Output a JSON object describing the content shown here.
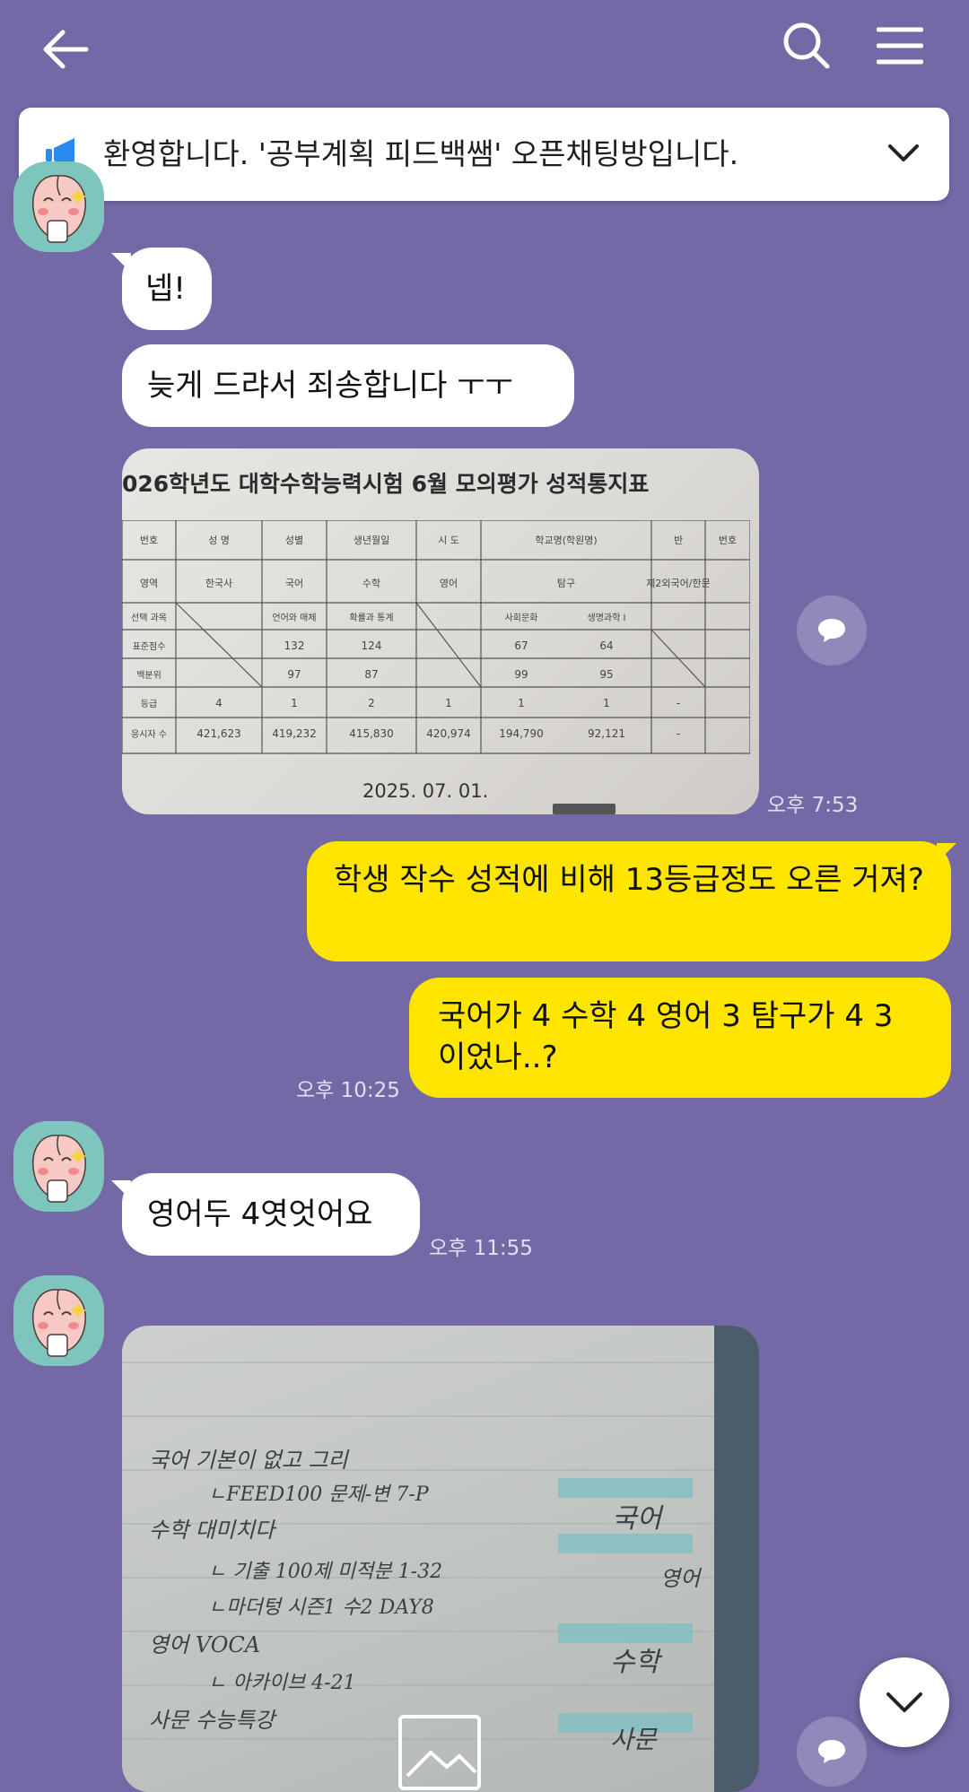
{
  "header": {
    "back_icon": "arrow-left-icon",
    "search_icon": "search-icon",
    "menu_icon": "menu-icon"
  },
  "notice": {
    "icon": "megaphone-icon",
    "text": "환영합니다. '공부계획  피드백쌤' 오픈채팅방입니다.",
    "expand_icon": "chevron-down-icon"
  },
  "messages": [
    {
      "side": "left",
      "text": "넵!"
    },
    {
      "side": "left",
      "text": "늦게 드랴서 죄송합니다 ㅜㅜ"
    },
    {
      "side": "left",
      "type": "photo",
      "time": "오후 7:53",
      "doc_title": "026학년도 대학수학능력시험 6월 모의평가 성적통지표",
      "doc_date": "2025. 07. 01."
    },
    {
      "side": "right",
      "text": "   학생 작수 성적에 비해 13등급정도 오른 거져?"
    },
    {
      "side": "right",
      "text": "국어가 4 수학 4 영어 3 탐구가 4 3 이었나..?",
      "time": "오후 10:25"
    },
    {
      "side": "left",
      "text": "영어두 4엿엇어요",
      "time": "오후 11:55"
    },
    {
      "side": "left",
      "type": "photo",
      "notes": [
        "국어   기본이 없고 그리",
        "ㄴFEED100 문제-변 7-P",
        "수학  대미치다",
        "ㄴ 기출 100제 미적분 1-32",
        "ㄴ마더텅 시즌1 수2 DAY8",
        "영어   VOCA",
        "ㄴ 아카이브 4-21",
        "사문  수능특강"
      ],
      "tabs": [
        "국어",
        "영어",
        "수학",
        "사문"
      ]
    }
  ],
  "table": {
    "header": [
      "번호",
      "성 명",
      "성별",
      "생년월일",
      "시 도",
      "학교명(학원명)",
      "반",
      "번호"
    ],
    "sub": [
      "영역",
      "한국사",
      "국어",
      "수학",
      "영어",
      "탐구",
      "제2외국어/한문"
    ],
    "sel": [
      "선택 과목",
      "",
      "언어와 매체",
      "확률과 통계",
      "",
      "사회문화",
      "생명과학 I",
      ""
    ],
    "rows": [
      {
        "label": "표준점수",
        "vals": [
          "",
          "132",
          "124",
          "",
          "67",
          "64",
          ""
        ]
      },
      {
        "label": "백분위",
        "vals": [
          "",
          "97",
          "87",
          "",
          "99",
          "95",
          ""
        ]
      },
      {
        "label": "등급",
        "vals": [
          "4",
          "1",
          "2",
          "1",
          "1",
          "1",
          "-"
        ]
      },
      {
        "label": "응시자 수",
        "vals": [
          "421,623",
          "419,232",
          "415,830",
          "420,974",
          "194,790",
          "92,121",
          "-"
        ]
      }
    ]
  },
  "colors": {
    "background": "#7568a6",
    "my_bubble": "#fee500",
    "their_bubble": "#ffffff"
  },
  "scroll_button": {
    "icon": "chevron-down-icon"
  }
}
